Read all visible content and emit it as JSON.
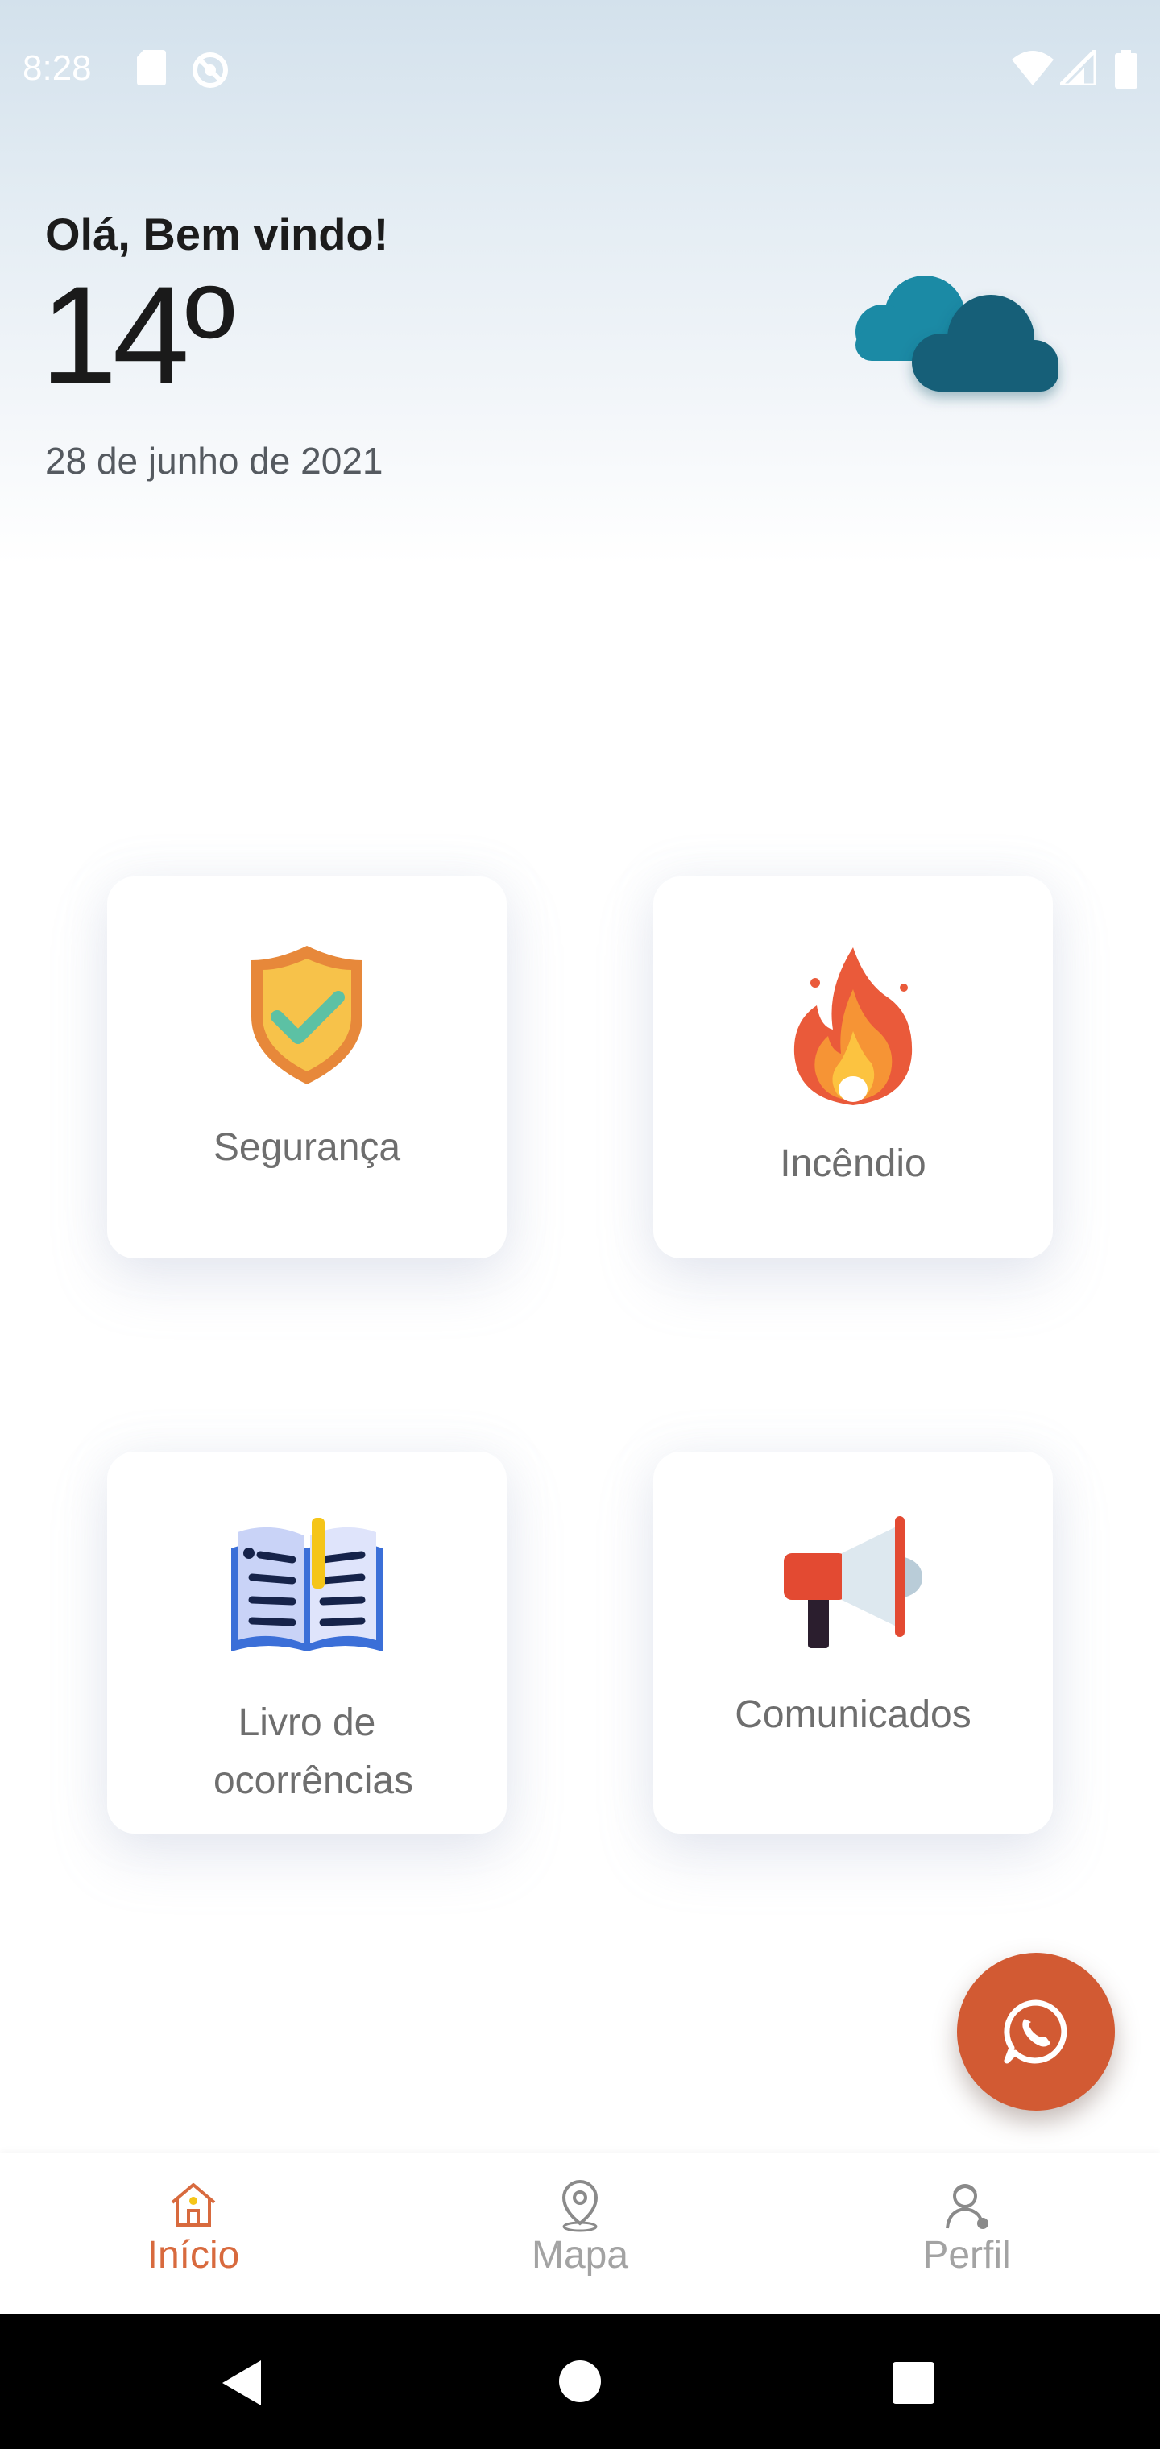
{
  "status_bar": {
    "time": "8:28",
    "icons": [
      "sd-card-icon",
      "sync-disabled-icon",
      "wifi-icon",
      "signal-icon",
      "battery-icon"
    ]
  },
  "header": {
    "greeting": "Olá, Bem vindo!",
    "temperature": "14º",
    "date": "28 de junho de 2021",
    "weather_icon": "cloud-icon"
  },
  "cards": [
    {
      "id": "seguranca",
      "label": "Segurança",
      "icon": "shield-check-icon"
    },
    {
      "id": "incendio",
      "label": "Incêndio",
      "icon": "fire-icon"
    },
    {
      "id": "livro",
      "label_line1": "Livro de",
      "label_line2": "ocorrências",
      "icon": "open-book-icon"
    },
    {
      "id": "comunicados",
      "label": "Comunicados",
      "icon": "megaphone-icon"
    }
  ],
  "fab": {
    "icon": "whatsapp-icon"
  },
  "bottom_nav": {
    "items": [
      {
        "label": "Início",
        "icon": "home-icon",
        "active": true
      },
      {
        "label": "Mapa",
        "icon": "map-pin-icon",
        "active": false
      },
      {
        "label": "Perfil",
        "icon": "profile-icon",
        "active": false
      }
    ]
  },
  "colors": {
    "accent": "#d25a33",
    "active_nav": "#d86a3e",
    "inactive_nav": "#a3a3a3",
    "cloud_light": "#1b8aa5",
    "cloud_dark": "#135f78"
  }
}
